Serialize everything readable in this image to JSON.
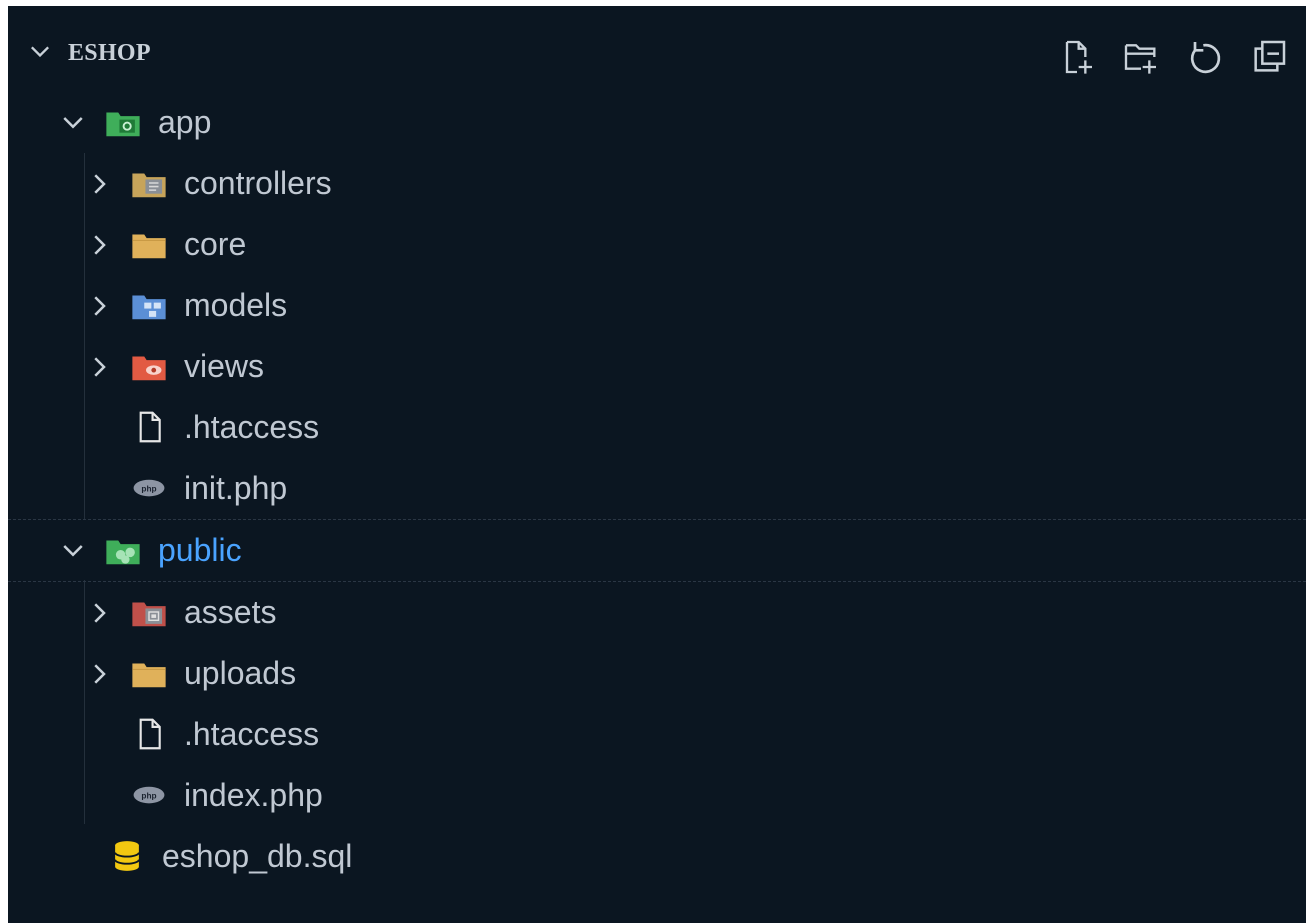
{
  "explorer": {
    "section_title": "ESHOP",
    "actions": [
      {
        "name": "new-file-icon",
        "tooltip": "New File"
      },
      {
        "name": "new-folder-icon",
        "tooltip": "New Folder"
      },
      {
        "name": "refresh-icon",
        "tooltip": "Refresh Explorer"
      },
      {
        "name": "collapse-all-icon",
        "tooltip": "Collapse Folders in Explorer"
      }
    ],
    "tree": [
      {
        "label": "app",
        "kind": "folder",
        "expanded": true,
        "depth": 0,
        "icon": "folder-app-icon"
      },
      {
        "label": "controllers",
        "kind": "folder",
        "expanded": false,
        "depth": 1,
        "icon": "folder-controllers-icon"
      },
      {
        "label": "core",
        "kind": "folder",
        "expanded": false,
        "depth": 1,
        "icon": "folder-icon"
      },
      {
        "label": "models",
        "kind": "folder",
        "expanded": false,
        "depth": 1,
        "icon": "folder-models-icon"
      },
      {
        "label": "views",
        "kind": "folder",
        "expanded": false,
        "depth": 1,
        "icon": "folder-views-icon"
      },
      {
        "label": ".htaccess",
        "kind": "file",
        "depth": 1,
        "icon": "file-icon"
      },
      {
        "label": "init.php",
        "kind": "file",
        "depth": 1,
        "icon": "php-file-icon"
      },
      {
        "label": "public",
        "kind": "folder",
        "expanded": true,
        "depth": 0,
        "icon": "folder-public-icon",
        "active": true
      },
      {
        "label": "assets",
        "kind": "folder",
        "expanded": false,
        "depth": 1,
        "icon": "folder-assets-icon"
      },
      {
        "label": "uploads",
        "kind": "folder",
        "expanded": false,
        "depth": 1,
        "icon": "folder-icon"
      },
      {
        "label": ".htaccess",
        "kind": "file",
        "depth": 1,
        "icon": "file-icon"
      },
      {
        "label": "index.php",
        "kind": "file",
        "depth": 1,
        "icon": "php-file-icon"
      },
      {
        "label": "eshop_db.sql",
        "kind": "file",
        "depth": 0,
        "icon": "database-icon",
        "root_file": true
      }
    ],
    "colors": {
      "background": "#0b1621",
      "text": "#c0c8d2",
      "active_text": "#4aa3ff",
      "folder_yellow": "#e0b15a",
      "folder_green": "#3fae5a",
      "folder_blue": "#5b8fd6",
      "folder_red": "#e25a43",
      "db_yellow": "#f2c811"
    }
  }
}
